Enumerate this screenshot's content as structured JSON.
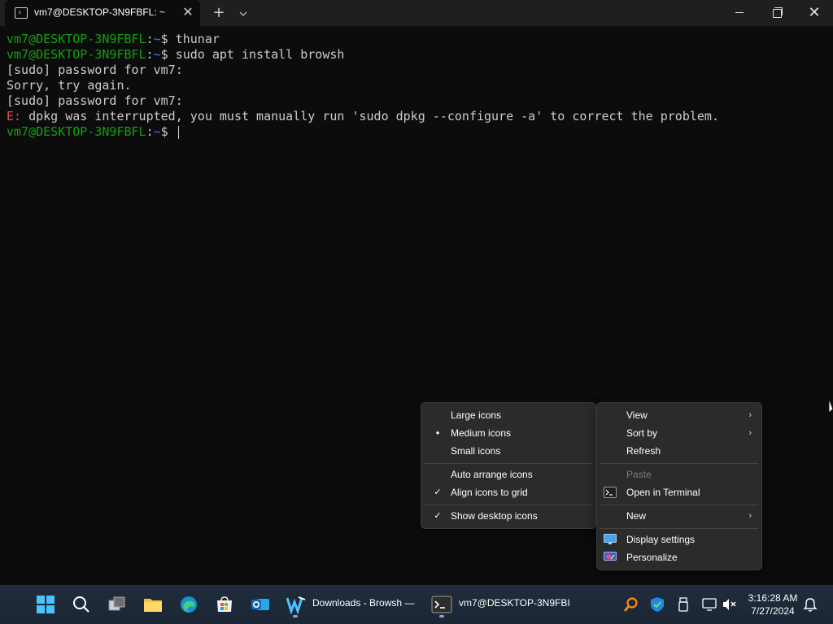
{
  "window": {
    "tab_title": "vm7@DESKTOP-3N9FBFL: ~",
    "tab_close": "✕",
    "new_tab": "+",
    "dropdown": "⌄",
    "close": "✕"
  },
  "terminal": {
    "lines": [
      {
        "user": "vm7@DESKTOP-3N9FBFL",
        "sep": ":",
        "path": "~",
        "prompt": "$ ",
        "cmd": "thunar"
      },
      {
        "user": "vm7@DESKTOP-3N9FBFL",
        "sep": ":",
        "path": "~",
        "prompt": "$ ",
        "cmd": "sudo apt install browsh"
      },
      {
        "text": "[sudo] password for vm7:"
      },
      {
        "text": "Sorry, try again."
      },
      {
        "text": "[sudo] password for vm7:"
      },
      {
        "err": "E:",
        "text": " dpkg was interrupted, you must manually run 'sudo dpkg --configure -a' to correct the problem."
      },
      {
        "user": "vm7@DESKTOP-3N9FBFL",
        "sep": ":",
        "path": "~",
        "prompt": "$ ",
        "cmd": ""
      }
    ]
  },
  "view_submenu": {
    "items": [
      {
        "label": "Large icons",
        "mark": ""
      },
      {
        "label": "Medium icons",
        "mark": "●"
      },
      {
        "label": "Small icons",
        "mark": ""
      },
      {
        "label": "Auto arrange icons",
        "mark": ""
      },
      {
        "label": "Align icons to grid",
        "mark": "✓"
      },
      {
        "label": "Show desktop icons",
        "mark": "✓"
      }
    ]
  },
  "context_menu": {
    "view": "View",
    "sort_by": "Sort by",
    "refresh": "Refresh",
    "paste": "Paste",
    "open_terminal": "Open in Terminal",
    "new": "New",
    "display_settings": "Display settings",
    "personalize": "Personalize",
    "arrow": "›"
  },
  "taskbar": {
    "app_downloads": "Downloads - Browsh —",
    "app_terminal": "vm7@DESKTOP-3N9FBI",
    "time": "3:16:28 AM",
    "date": "7/27/2024"
  },
  "colors": {
    "prompt_user": "#13a10e",
    "prompt_path": "#3b78ff",
    "error": "#e74856",
    "accent": "#0078d4"
  }
}
